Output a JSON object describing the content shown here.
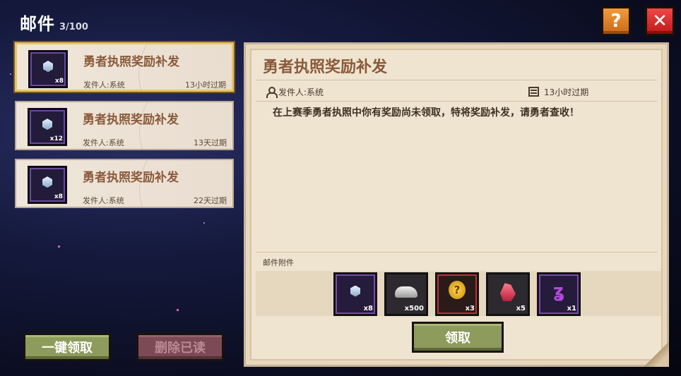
{
  "header": {
    "title": "邮件",
    "count": "3/100",
    "help_icon": "?",
    "close_icon": "✕"
  },
  "mail_list": [
    {
      "title": "勇者执照奖励补发",
      "sender": "发件人:系统",
      "expire": "13小时过期",
      "qty": "x8",
      "selected": true
    },
    {
      "title": "勇者执照奖励补发",
      "sender": "发件人:系统",
      "expire": "13天过期",
      "qty": "x12",
      "selected": false
    },
    {
      "title": "勇者执照奖励补发",
      "sender": "发件人:系统",
      "expire": "22天过期",
      "qty": "x8",
      "selected": false
    }
  ],
  "buttons": {
    "claim_all": "一键领取",
    "delete_read": "删除已读"
  },
  "detail": {
    "title": "勇者执照奖励补发",
    "sender": "发件人:系统",
    "expire": "13小时过期",
    "body": "在上赛季勇者执照中你有奖励尚未领取，特将奖励补发，请勇者查收！",
    "attachments_label": "邮件附件",
    "attachments": [
      {
        "icon": "crystal-gem-icon",
        "qty": "x8"
      },
      {
        "icon": "silver-ore-icon",
        "qty": "x500"
      },
      {
        "icon": "gold-question-coin-icon",
        "qty": "x3",
        "glyph": "?"
      },
      {
        "icon": "red-crystal-icon",
        "qty": "x5"
      },
      {
        "icon": "purple-rune-icon",
        "qty": "x1",
        "glyph": "ʓ"
      }
    ],
    "claim_button": "领取"
  },
  "colors": {
    "accent_gold": "#e6c36a",
    "title_brown": "#8a5a3a",
    "button_green": "#8d9b5c",
    "button_maroon": "#7c4a57",
    "close_red": "#d82a2a",
    "help_orange": "#e0822a"
  }
}
